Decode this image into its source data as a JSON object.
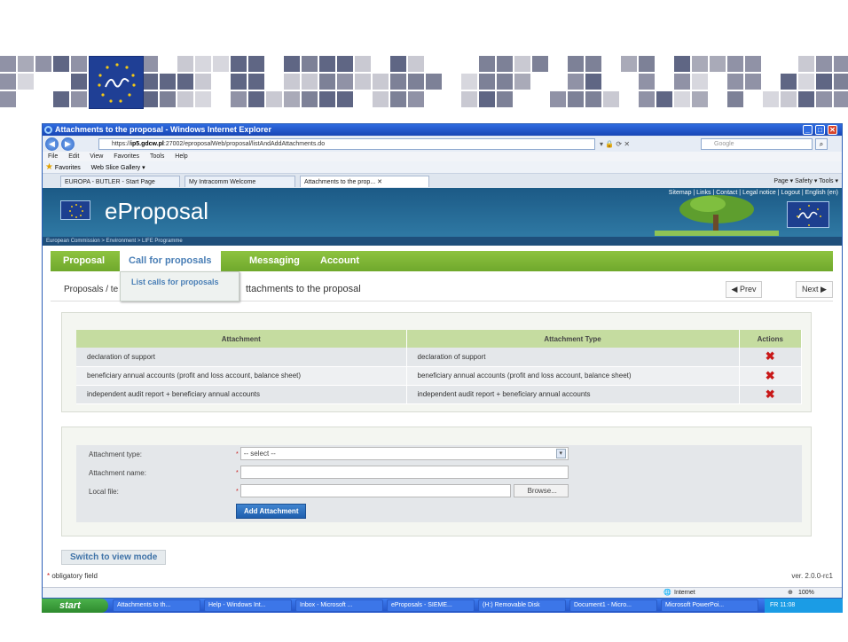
{
  "browser": {
    "window_title": "Attachments to the proposal - Windows Internet Explorer",
    "url_scheme": "https://",
    "url_host": "ip5.gdcw.pl",
    "url_path": ":27002/eproposalWeb/proposal/listAndAddAttachments.do",
    "search_placeholder": "Google",
    "menu": [
      "File",
      "Edit",
      "View",
      "Favorites",
      "Tools",
      "Help"
    ],
    "favorites_label": "Favorites",
    "web_slice_label": "Web Slice Gallery ▾",
    "tabs": [
      {
        "label": "EUROPA - BUTLER - Start Page"
      },
      {
        "label": "My Intracomm Welcome"
      },
      {
        "label": "Attachments to the prop...  ✕"
      }
    ],
    "command_bar": "Page ▾   Safety ▾   Tools ▾",
    "status_zone": "Internet",
    "zoom": "100%"
  },
  "site": {
    "top_links": "Sitemap | Links | Contact | Legal notice | Logout | English (en)",
    "brand": "eProposal",
    "crumb_bar": "European Commission  > Environment  > LIFE Programme",
    "nav": [
      "Proposal",
      "Call for proposals",
      "Messaging",
      "Account"
    ],
    "dropdown_item": "List calls for proposals",
    "crumb_prefix": "Proposals / te",
    "page_title": "ttachments to the proposal",
    "prev_label": "◀ Prev",
    "next_label": "Next ▶"
  },
  "attachments": {
    "columns": [
      "Attachment",
      "Attachment Type",
      "Actions"
    ],
    "rows": [
      {
        "attachment": "declaration of support",
        "type": "declaration of support"
      },
      {
        "attachment": "beneficiary annual accounts (profit and loss account, balance sheet)",
        "type": "beneficiary annual accounts (profit and loss account, balance sheet)"
      },
      {
        "attachment": "independent audit report + beneficiary annual accounts",
        "type": "independent audit report + beneficiary annual accounts"
      }
    ]
  },
  "form": {
    "type_label": "Attachment type:",
    "type_value": "-- select --",
    "name_label": "Attachment name:",
    "file_label": "Local file:",
    "browse_label": "Browse...",
    "add_label": "Add Attachment"
  },
  "footer": {
    "switch_label": "Switch to view mode",
    "required_note": "obligatory field",
    "version": "ver. 2.0.0-rc1"
  },
  "taskbar": {
    "start_label": "start",
    "items": [
      "Attachments to th...",
      "Help - Windows Int...",
      "Inbox - Microsoft ...",
      "eProposals - SIEME...",
      "(H:) Removable Disk",
      "Document1 - Micro...",
      "Microsoft PowerPoi..."
    ],
    "tray": "FR   11:08"
  }
}
